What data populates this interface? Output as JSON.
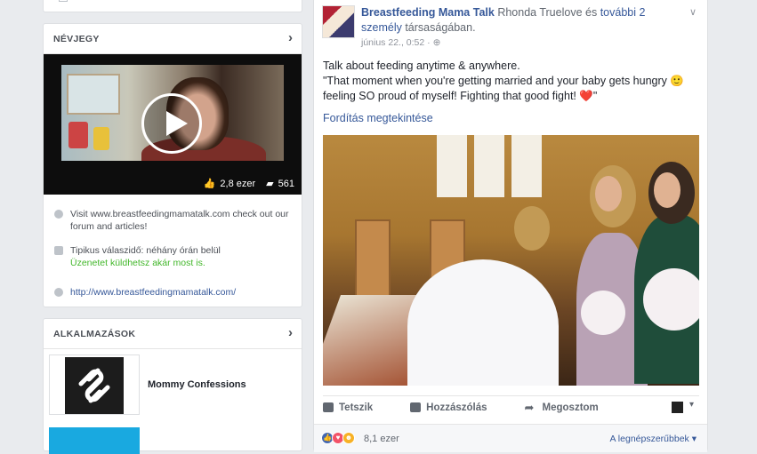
{
  "about": {
    "title": "NÉVJEGY",
    "video": {
      "likes": "2,8 ezer",
      "comments": "561"
    },
    "website_text": "Visit www.breastfeedingmamatalk.com check out our forum and articles!",
    "response_time": "Tipikus válaszidő: néhány órán belül",
    "message_now": "Üzenetet küldhetsz akár most is.",
    "url": "http://www.breastfeedingmamatalk.com/"
  },
  "apps": {
    "title": "ALKALMAZÁSOK",
    "items": [
      {
        "name": "Mommy Confessions"
      }
    ]
  },
  "post": {
    "page_name": "Breastfeeding Mama Talk",
    "with_text": "Rhonda Truelove és",
    "others_link": "további 2 személy",
    "with_suffix": "társaságában.",
    "timestamp": "június 22., 0:52 · ",
    "text_line1": "Talk about feeding anytime & anywhere.",
    "text_line2": "\"That moment when you're getting married and your baby gets hungry 🙂 feeling SO proud of myself! Fighting that good fight! ❤️\"",
    "translate": "Fordítás megtekintése",
    "actions": {
      "like": "Tetszik",
      "comment": "Hozzászólás",
      "share": "Megosztom"
    },
    "reaction_count": "8,1 ezer",
    "sort": "A legnépszerűbbek"
  },
  "colors": {
    "link": "#365899",
    "bg": "#e9ebee",
    "green": "#42b72a"
  },
  "icons": [
    "chevron-right-icon",
    "play-icon",
    "like-icon",
    "comment-icon",
    "globe-icon",
    "chat-icon",
    "link-icon",
    "share-icon"
  ]
}
